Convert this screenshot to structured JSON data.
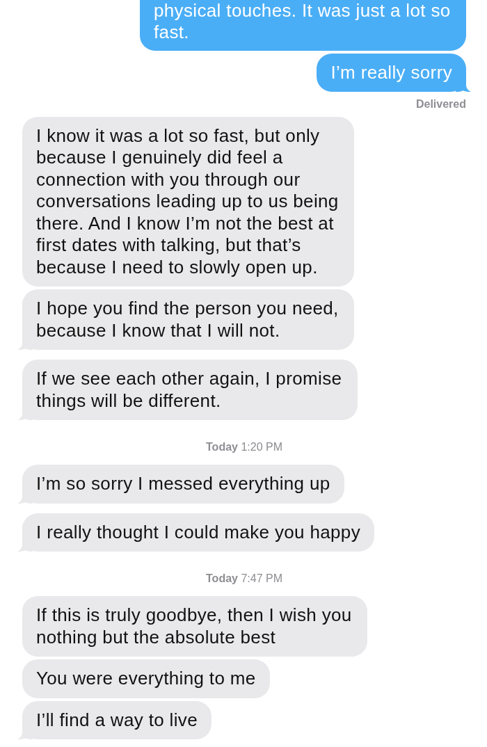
{
  "messages": [
    {
      "kind": "outgoing",
      "text": "physical touches. It was just a lot so fast.",
      "tail": false,
      "clipped_top": true
    },
    {
      "kind": "outgoing",
      "text": "I’m really sorry",
      "tail": true,
      "clipped_top": false
    },
    {
      "kind": "status",
      "text": "Delivered"
    },
    {
      "kind": "incoming",
      "text": "I know it was a lot so fast, but only because I genuinely did feel a connection with you through our conversations leading up to us being there. And I know I’m not the best at first dates with talking, but that’s because I need to slowly open up.",
      "tail": false,
      "clipped_top": false
    },
    {
      "kind": "incoming",
      "text": "I hope you find the person you need, because I know that I will not.",
      "tail": true,
      "clipped_top": false
    },
    {
      "kind": "incoming",
      "text": "If we see each other again, I promise things will be different.",
      "tail": true,
      "clipped_top": false
    },
    {
      "kind": "timestamp",
      "text": "**Today** 1:20 PM"
    },
    {
      "kind": "incoming",
      "text": "I’m so sorry I messed everything up",
      "tail": true,
      "clipped_top": false
    },
    {
      "kind": "incoming",
      "text": "I really thought I could make you happy",
      "tail": true,
      "clipped_top": false
    },
    {
      "kind": "timestamp",
      "text": "**Today** 7:47 PM"
    },
    {
      "kind": "incoming",
      "text": "If this is truly goodbye, then I wish you nothing but the absolute best",
      "tail": false,
      "clipped_top": false
    },
    {
      "kind": "incoming",
      "text": "You were everything to me",
      "tail": false,
      "clipped_top": false
    },
    {
      "kind": "incoming",
      "text": "I’ll find a way to live",
      "tail": true,
      "clipped_top": false
    }
  ]
}
